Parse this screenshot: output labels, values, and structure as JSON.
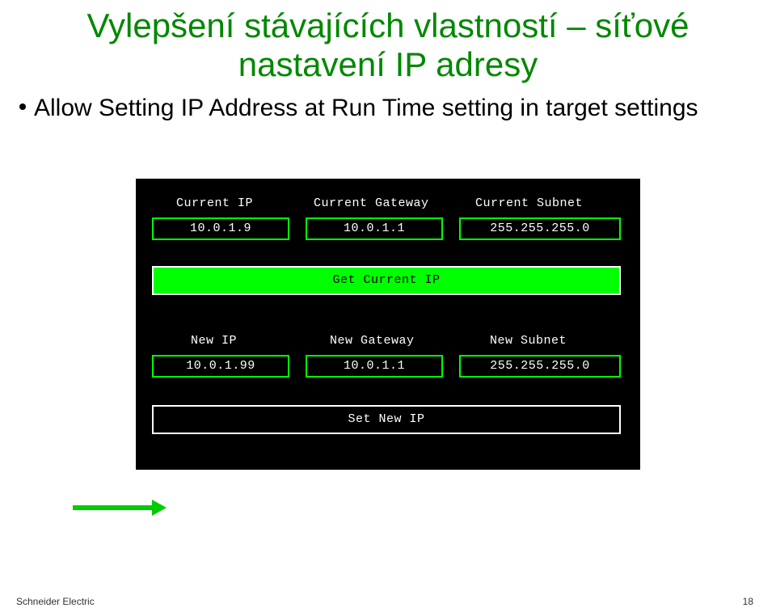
{
  "title_line1": "Vylepšení stávajících vlastností – síťové",
  "title_line2": "nastavení IP adresy",
  "bullet_text": "Allow Setting IP Address at Run Time setting in target settings",
  "hmi": {
    "labels": {
      "current_ip": "Current IP",
      "current_gateway": "Current Gateway",
      "current_subnet": "Current Subnet",
      "new_ip": "New IP",
      "new_gateway": "New Gateway",
      "new_subnet": "New Subnet"
    },
    "values": {
      "current_ip": "10.0.1.9",
      "current_gateway": "10.0.1.1",
      "current_subnet": "255.255.255.0",
      "new_ip": "10.0.1.99",
      "new_gateway": "10.0.1.1",
      "new_subnet": "255.255.255.0"
    },
    "buttons": {
      "get": "Get Current IP",
      "set": "Set New IP"
    }
  },
  "footer": {
    "brand": "Schneider Electric",
    "page": "18"
  }
}
